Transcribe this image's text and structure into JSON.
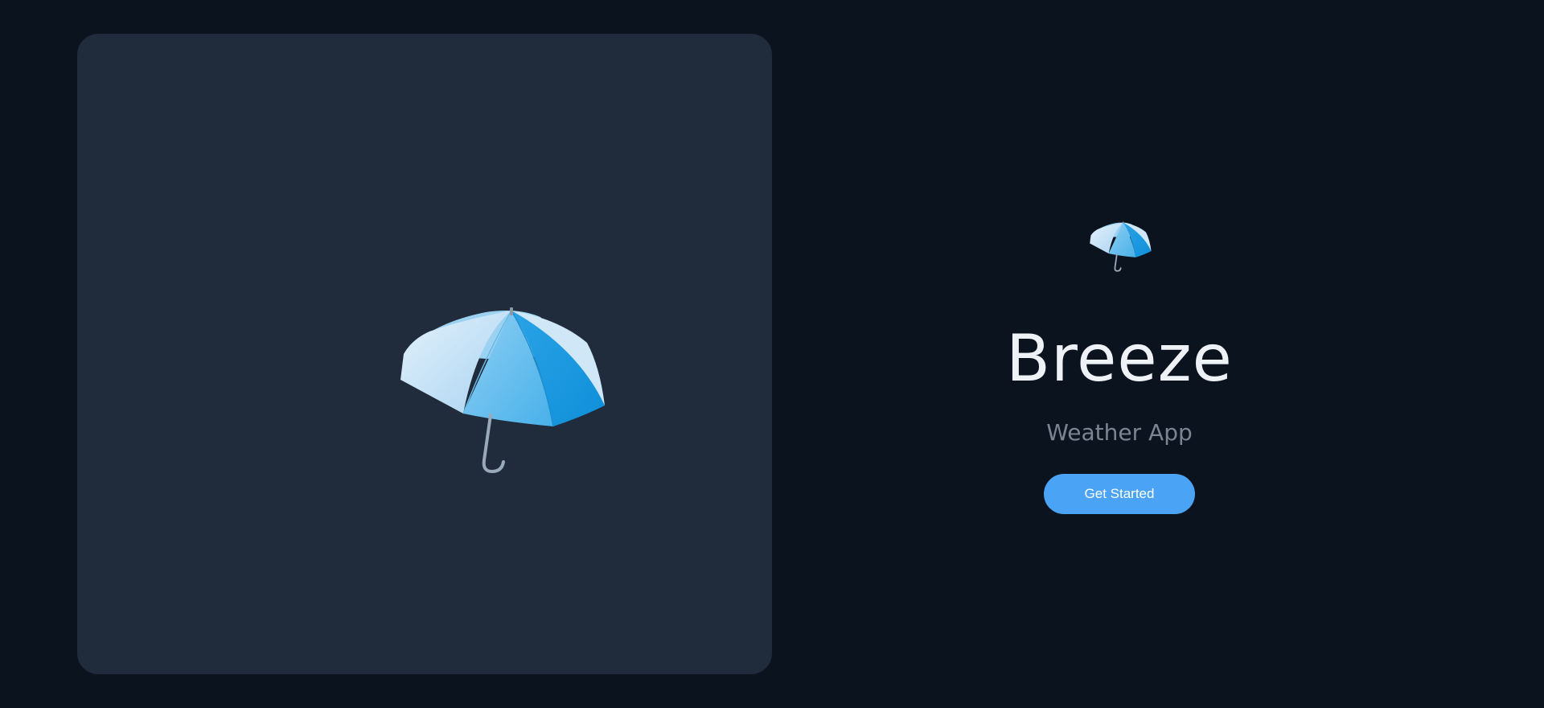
{
  "hero": {
    "illustration_icon": "umbrella-icon"
  },
  "branding": {
    "logo_icon": "umbrella-icon",
    "app_name": "Breeze",
    "tagline": "Weather App"
  },
  "actions": {
    "get_started_label": "Get Started"
  },
  "colors": {
    "background": "#0b131e",
    "card": "#202b3b",
    "accent": "#4aa3f5",
    "title": "#eef1f5",
    "subtitle": "#7a8493"
  }
}
